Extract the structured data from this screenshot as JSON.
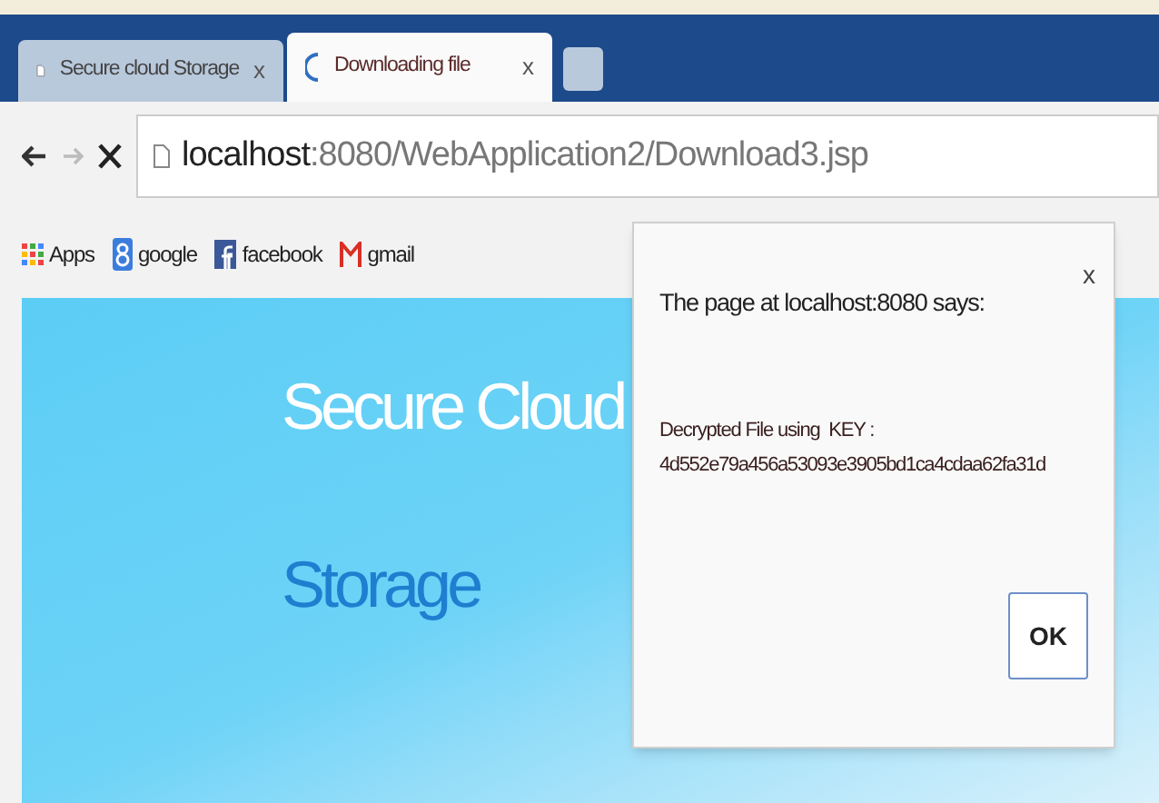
{
  "tabs": [
    {
      "title": "Secure cloud Storage",
      "close": "x",
      "selected": false,
      "loading": false
    },
    {
      "title": "Downloading file",
      "close": "x",
      "selected": true,
      "loading": true
    }
  ],
  "toolbar": {
    "url_host": "localhost",
    "url_path": ":8080/WebApplication2/Download3.jsp"
  },
  "bookmarks": [
    {
      "kind": "apps",
      "label": "Apps"
    },
    {
      "kind": "google",
      "label": "google"
    },
    {
      "kind": "facebook",
      "label": "facebook"
    },
    {
      "kind": "gmail",
      "label": "gmail"
    }
  ],
  "page": {
    "heading_line_1": "Secure Cloud",
    "heading_line_2": "Storage"
  },
  "dialog": {
    "title": "The page at localhost:8080 says:",
    "close": "x",
    "message": "Decrypted File using  KEY :",
    "key": "4d552e79a456a53093e3905bd1ca4cdaa62fa31d",
    "ok": "OK"
  }
}
